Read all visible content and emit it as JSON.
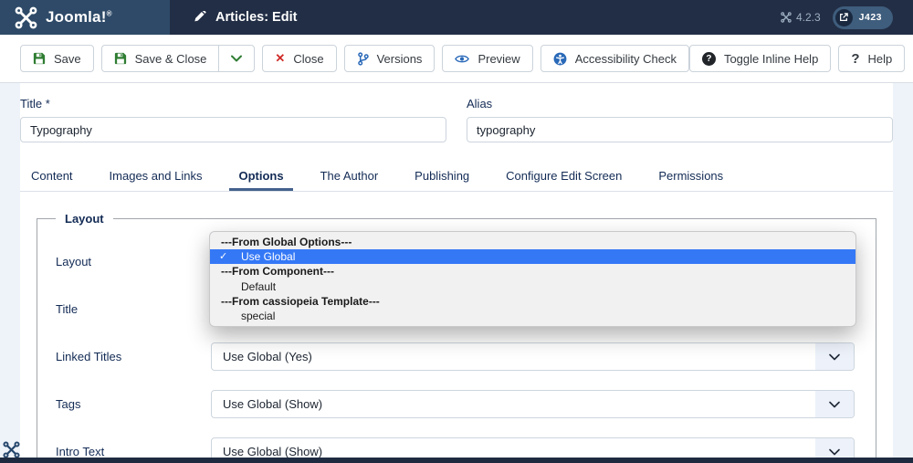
{
  "header": {
    "brand": "Joomla!",
    "brand_reg": "®",
    "title": "Articles: Edit",
    "version": "4.2.3",
    "badge": "J423"
  },
  "toolbar": {
    "save": "Save",
    "save_close": "Save & Close",
    "close": "Close",
    "versions": "Versions",
    "preview": "Preview",
    "accessibility": "Accessibility Check",
    "toggle_inline_help": "Toggle Inline Help",
    "help": "Help"
  },
  "form": {
    "title_label": "Title *",
    "title_value": "Typography",
    "alias_label": "Alias",
    "alias_value": "typography"
  },
  "tabs": {
    "active": "Options",
    "items": [
      {
        "label": "Content"
      },
      {
        "label": "Images and Links"
      },
      {
        "label": "Options"
      },
      {
        "label": "The Author"
      },
      {
        "label": "Publishing"
      },
      {
        "label": "Configure Edit Screen"
      },
      {
        "label": "Permissions"
      }
    ]
  },
  "options_panel": {
    "legend": "Layout",
    "rows": [
      {
        "label": "Layout",
        "value": "Use Global"
      },
      {
        "label": "Title",
        "value": ""
      },
      {
        "label": "Linked Titles",
        "value": "Use Global (Yes)"
      },
      {
        "label": "Tags",
        "value": "Use Global (Show)"
      },
      {
        "label": "Intro Text",
        "value": "Use Global (Show)"
      }
    ]
  },
  "dropdown": {
    "check": "✓",
    "items": [
      {
        "type": "group",
        "label": "---From Global Options---"
      },
      {
        "type": "option",
        "label": "Use Global",
        "selected": true
      },
      {
        "type": "group",
        "label": "---From Component---"
      },
      {
        "type": "option",
        "label": "Default"
      },
      {
        "type": "group",
        "label": "---From cassiopeia Template---"
      },
      {
        "type": "option",
        "label": "special"
      }
    ]
  },
  "colors": {
    "header_bg": "#222e45",
    "brand_bg": "#2e4a68",
    "accent_blue": "#2a69b8",
    "highlight_blue": "#3478f6",
    "save_green": "#2f7d32",
    "close_red": "#cf2a27",
    "label_navy": "#132b55"
  }
}
